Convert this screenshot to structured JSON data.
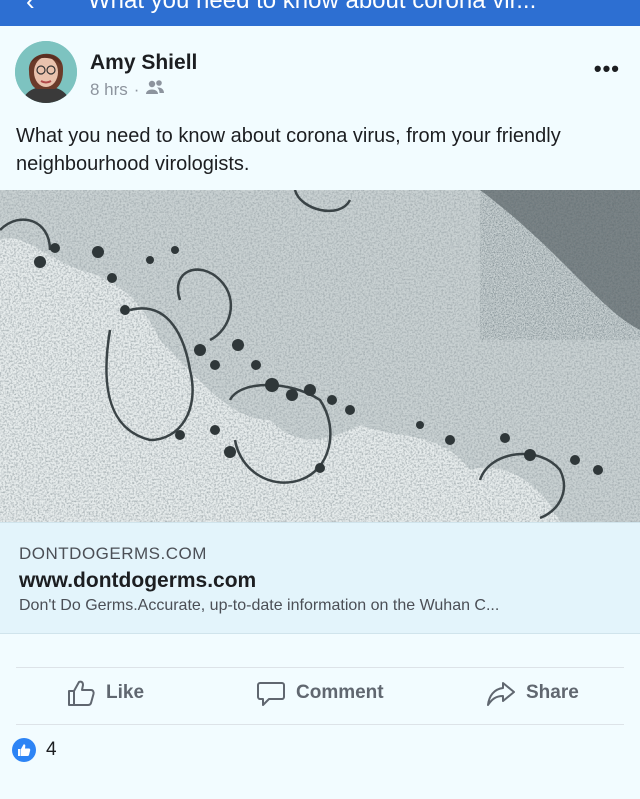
{
  "topbar": {
    "back_glyph": "‹",
    "title": "What you need to know about corona vir..."
  },
  "post": {
    "author": "Amy Shiell",
    "time": "8 hrs",
    "separator": "·",
    "audience_icon": "friends-icon",
    "more_glyph": "•••",
    "text": "What you need to know about corona virus, from your friendly neighbourhood virologists."
  },
  "link": {
    "domain": "DONTDOGERMS.COM",
    "url": "www.dontdogerms.com",
    "description": "Don't Do Germs.Accurate, up-to-date information on the Wuhan C..."
  },
  "actions": {
    "like": "Like",
    "comment": "Comment",
    "share": "Share"
  },
  "reactions": {
    "count": "4",
    "icon": "like-icon"
  },
  "colors": {
    "brand": "#2d6fd2",
    "like": "#2d84f5",
    "link_bg": "#e3f4fb"
  }
}
